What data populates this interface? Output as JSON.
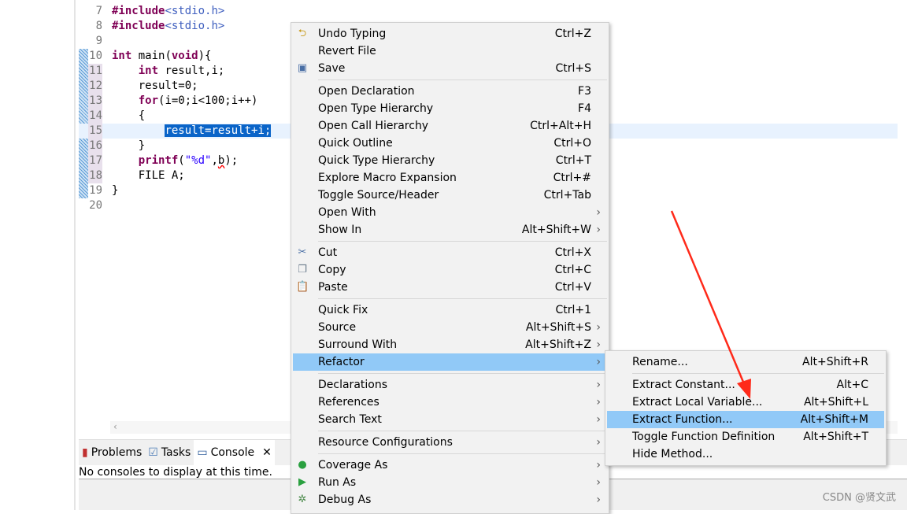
{
  "editor": {
    "lines": [
      {
        "n": "7",
        "c": [
          [
            "inc-kw",
            "#include"
          ],
          [
            "inc",
            "<stdio.h>"
          ]
        ]
      },
      {
        "n": "8",
        "c": [
          [
            "inc-kw",
            "#include"
          ],
          [
            "inc",
            "<stdio.h>"
          ]
        ]
      },
      {
        "n": "9",
        "c": []
      },
      {
        "n": "10",
        "c": [
          [
            "kw",
            "int"
          ],
          [
            "t",
            " main("
          ],
          [
            "kw",
            "void"
          ],
          [
            "t",
            "){"
          ]
        ]
      },
      {
        "n": "11",
        "c": [
          [
            "t",
            "    "
          ],
          [
            "kw",
            "int"
          ],
          [
            "t",
            " result,i;"
          ]
        ]
      },
      {
        "n": "12",
        "c": [
          [
            "t",
            "    result=0;"
          ]
        ]
      },
      {
        "n": "13",
        "c": [
          [
            "t",
            "    "
          ],
          [
            "kw",
            "for"
          ],
          [
            "t",
            "(i=0;i<100;i++)"
          ]
        ]
      },
      {
        "n": "14",
        "c": [
          [
            "t",
            "    {"
          ]
        ]
      },
      {
        "n": "15",
        "c": [
          [
            "t",
            "        "
          ],
          [
            "hl",
            "result=result+i;"
          ]
        ]
      },
      {
        "n": "16",
        "c": [
          [
            "t",
            "    }"
          ]
        ]
      },
      {
        "n": "17",
        "c": [
          [
            "t",
            "    "
          ],
          [
            "kw",
            "printf"
          ],
          [
            "t",
            "("
          ],
          [
            "str",
            "\"%d\""
          ],
          [
            "t",
            ","
          ],
          [
            "sq",
            "b"
          ],
          [
            "t",
            ");"
          ]
        ]
      },
      {
        "n": "18",
        "c": [
          [
            "t",
            "    FILE A;"
          ]
        ]
      },
      {
        "n": "19",
        "c": [
          [
            "t",
            "}"
          ]
        ]
      },
      {
        "n": "20",
        "c": []
      }
    ]
  },
  "panel": {
    "tabs": [
      {
        "label": "Problems",
        "icon": "problems-icon"
      },
      {
        "label": "Tasks",
        "icon": "tasks-icon"
      },
      {
        "label": "Console",
        "icon": "console-icon"
      }
    ],
    "message": "No consoles to display at this time."
  },
  "menu": [
    {
      "label": "Undo Typing",
      "sc": "Ctrl+Z",
      "icon": "undo-icon"
    },
    {
      "label": "Revert File",
      "sc": ""
    },
    {
      "label": "Save",
      "sc": "Ctrl+S",
      "icon": "save-icon"
    },
    {
      "sep": true
    },
    {
      "label": "Open Declaration",
      "sc": "F3"
    },
    {
      "label": "Open Type Hierarchy",
      "sc": "F4"
    },
    {
      "label": "Open Call Hierarchy",
      "sc": "Ctrl+Alt+H"
    },
    {
      "label": "Quick Outline",
      "sc": "Ctrl+O"
    },
    {
      "label": "Quick Type Hierarchy",
      "sc": "Ctrl+T"
    },
    {
      "label": "Explore Macro Expansion",
      "sc": "Ctrl+#"
    },
    {
      "label": "Toggle Source/Header",
      "sc": "Ctrl+Tab"
    },
    {
      "label": "Open With",
      "sc": "",
      "sub": true
    },
    {
      "label": "Show In",
      "sc": "Alt+Shift+W",
      "sub": true
    },
    {
      "sep": true
    },
    {
      "label": "Cut",
      "sc": "Ctrl+X",
      "icon": "cut-icon"
    },
    {
      "label": "Copy",
      "sc": "Ctrl+C",
      "icon": "copy-icon"
    },
    {
      "label": "Paste",
      "sc": "Ctrl+V",
      "icon": "paste-icon"
    },
    {
      "sep": true
    },
    {
      "label": "Quick Fix",
      "sc": "Ctrl+1"
    },
    {
      "label": "Source",
      "sc": "Alt+Shift+S",
      "sub": true
    },
    {
      "label": "Surround With",
      "sc": "Alt+Shift+Z",
      "sub": true
    },
    {
      "label": "Refactor",
      "sc": "",
      "sub": true,
      "hot": true
    },
    {
      "sep": true
    },
    {
      "label": "Declarations",
      "sc": "",
      "sub": true
    },
    {
      "label": "References",
      "sc": "",
      "sub": true
    },
    {
      "label": "Search Text",
      "sc": "",
      "sub": true
    },
    {
      "sep": true
    },
    {
      "label": "Resource Configurations",
      "sc": "",
      "sub": true
    },
    {
      "sep": true
    },
    {
      "label": "Coverage As",
      "sc": "",
      "sub": true,
      "icon": "coverage-icon"
    },
    {
      "label": "Run As",
      "sc": "",
      "sub": true,
      "icon": "run-icon"
    },
    {
      "label": "Debug As",
      "sc": "",
      "sub": true,
      "icon": "debug-icon"
    }
  ],
  "submenu": [
    {
      "label": "Rename...",
      "sc": "Alt+Shift+R"
    },
    {
      "sep": true
    },
    {
      "label": "Extract Constant...",
      "sc": "Alt+C"
    },
    {
      "label": "Extract Local Variable...",
      "sc": "Alt+Shift+L"
    },
    {
      "label": "Extract Function...",
      "sc": "Alt+Shift+M",
      "hot": true
    },
    {
      "label": "Toggle Function Definition",
      "sc": "Alt+Shift+T"
    },
    {
      "label": "Hide Method...",
      "sc": ""
    }
  ],
  "watermark": "CSDN @贤文武",
  "colors": {
    "selection": "#0a64c8",
    "menu_highlight": "#91c9f7",
    "arrow": "#ff2a1a"
  }
}
